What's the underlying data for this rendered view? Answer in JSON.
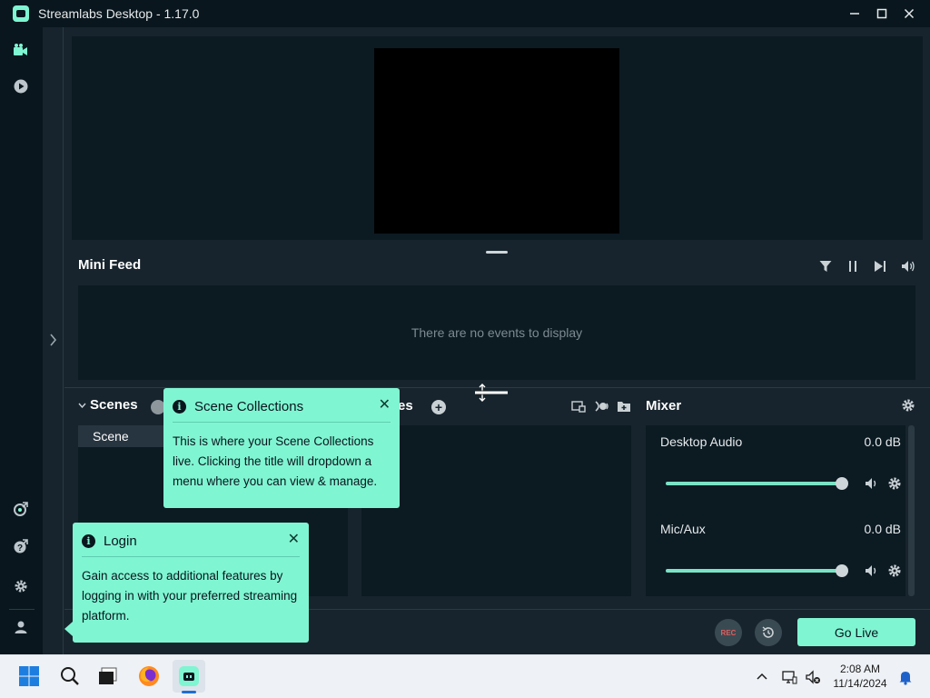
{
  "window": {
    "title": "Streamlabs Desktop - 1.17.0"
  },
  "minifeed": {
    "title": "Mini Feed",
    "empty_text": "There are no events to display"
  },
  "scenes": {
    "title": "Scenes",
    "items": [
      "Scene"
    ]
  },
  "sources": {
    "title_visible": "es"
  },
  "mixer": {
    "title": "Mixer",
    "channels": [
      {
        "name": "Desktop Audio",
        "db": "0.0 dB",
        "level": 1.0
      },
      {
        "name": "Mic/Aux",
        "db": "0.0 dB",
        "level": 1.0
      }
    ]
  },
  "footer": {
    "rec_label": "REC",
    "golive_label": "Go Live"
  },
  "tooltips": {
    "scene_collections": {
      "title": "Scene Collections",
      "body": "This is where your Scene Collections live. Clicking the title will dropdown a menu where you can view & manage."
    },
    "login": {
      "title": "Login",
      "body": "Gain access to additional features by logging in with your preferred streaming platform."
    }
  },
  "taskbar": {
    "time": "2:08 AM",
    "date": "11/14/2024"
  },
  "colors": {
    "accent": "#80f5d2",
    "background": "#17242d",
    "panel": "#0c1a22",
    "nav": "#09161d"
  }
}
